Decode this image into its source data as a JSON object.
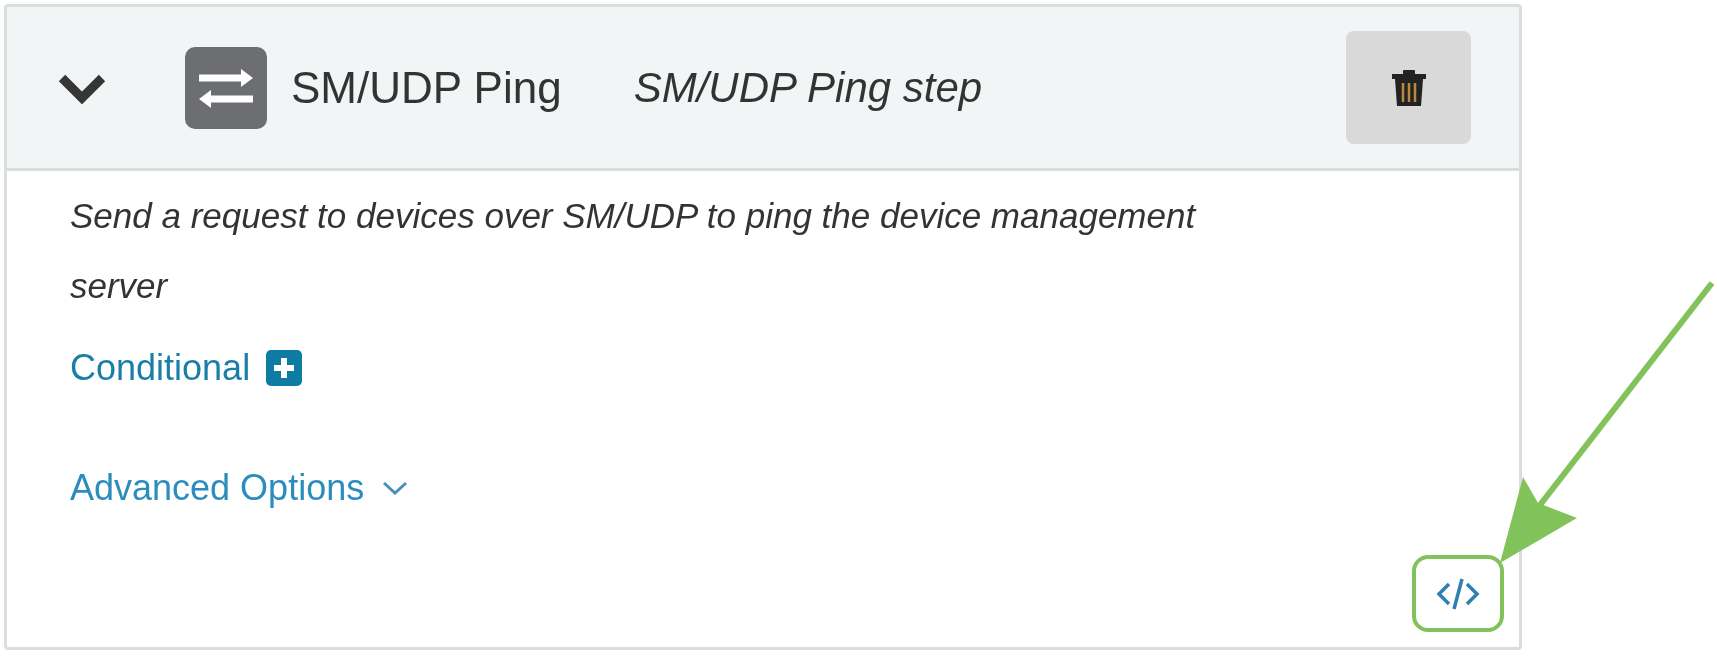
{
  "step": {
    "expanded": true,
    "title": "SM/UDP Ping",
    "subtitle": "SM/UDP Ping step",
    "description": "Send a request to devices over SM/UDP to ping the device management server",
    "conditional_label": "Conditional",
    "advanced_options": {
      "label": "Advanced Options",
      "expanded": false
    },
    "code_button": {
      "highlighted": true
    }
  }
}
